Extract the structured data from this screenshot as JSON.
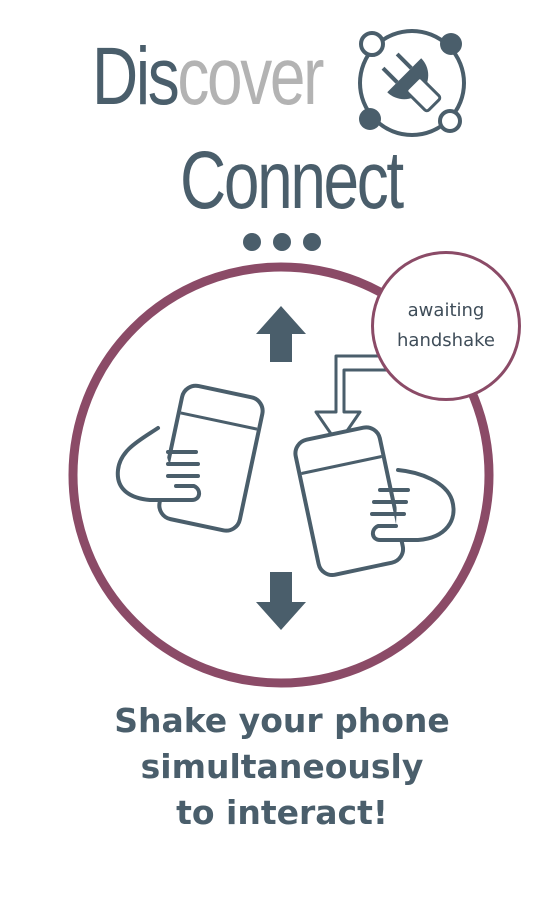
{
  "header": {
    "title_part1": "Dis",
    "title_part2": "cover",
    "subtitle": "Connect",
    "logo_icon": "plug-network-icon"
  },
  "loading_indicator": {
    "dots": 3,
    "color": "#4a5e6b"
  },
  "status": {
    "line1": "awaiting",
    "line2": "handshake"
  },
  "illustration": {
    "ring_color": "#8b4b67",
    "arrow_color": "#4a5e6b",
    "icons": [
      "arrow-up-icon",
      "arrow-down-icon",
      "hand-holding-phone-icon",
      "bent-arrow-icon"
    ]
  },
  "instructions": {
    "line1": "Shake your phone",
    "line2": "simultaneously",
    "line3": "to interact!"
  },
  "colors": {
    "primary": "#4a5e6b",
    "accent": "#8b4b67",
    "muted": "#b3b3b3"
  }
}
